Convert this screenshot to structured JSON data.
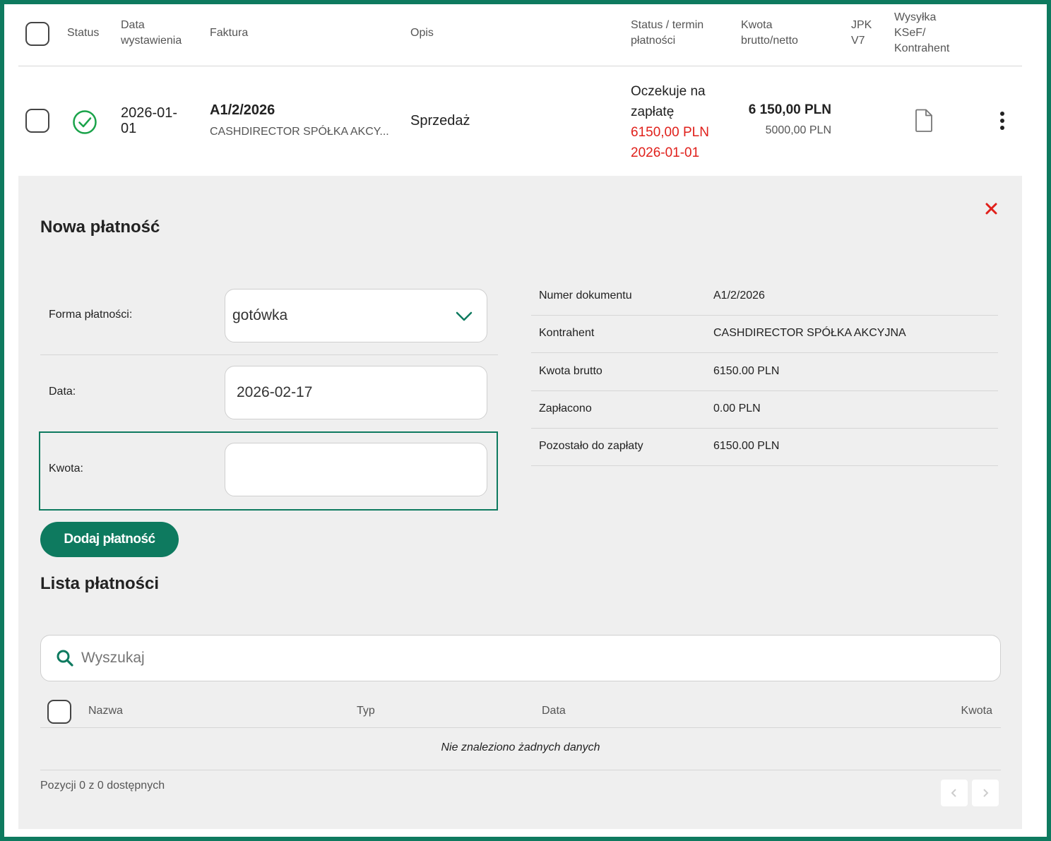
{
  "table": {
    "headers": {
      "status": "Status",
      "data_wystawienia": [
        "Data",
        "wystawienia"
      ],
      "faktura": "Faktura",
      "opis": "Opis",
      "status_termin": [
        "Status / termin",
        "płatności"
      ],
      "kwota": [
        "Kwota",
        "brutto/netto"
      ],
      "jpk": [
        "JPK",
        "V7"
      ],
      "wysylka": [
        "Wysyłka",
        "KSeF/",
        "Kontrahent"
      ]
    },
    "row": {
      "date": [
        "2026-01-",
        "01"
      ],
      "invoice_number": "A1/2/2026",
      "invoice_counterparty": "CASHDIRECTOR SPÓŁKA AKCY...",
      "description": "Sprzedaż",
      "payment_status": [
        "Oczekuje na",
        "zapłatę"
      ],
      "payment_amount": "6150,00 PLN",
      "payment_due": "2026-01-01",
      "gross": "6 150,00 PLN",
      "net": "5000,00 PLN"
    }
  },
  "payment_form": {
    "title": "Nowa płatność",
    "method_label": "Forma płatności:",
    "method_value": "gotówka",
    "date_label": "Data:",
    "date_value": "2026-02-17",
    "amount_label": "Kwota:",
    "amount_value": "",
    "submit_label": "Dodaj płatność"
  },
  "document_info": [
    {
      "label": "Numer dokumentu",
      "value": "A1/2/2026"
    },
    {
      "label": "Kontrahent",
      "value": "CASHDIRECTOR SPÓŁKA AKCYJNA"
    },
    {
      "label": "Kwota brutto",
      "value": "6150.00 PLN"
    },
    {
      "label": "Zapłacono",
      "value": "0.00 PLN"
    },
    {
      "label": "Pozostało do zapłaty",
      "value": "6150.00 PLN"
    }
  ],
  "payment_list": {
    "title": "Lista płatności",
    "search_placeholder": "Wyszukaj",
    "columns": {
      "name": "Nazwa",
      "type": "Typ",
      "date": "Data",
      "amount": "Kwota"
    },
    "empty_message": "Nie znaleziono żadnych danych",
    "footer": "Pozycji 0 z 0 dostępnych"
  },
  "colors": {
    "accent": "#0e7a5f",
    "danger": "#e0201b",
    "ok": "#1aa34a"
  },
  "icons": {
    "status": "check-circle-icon",
    "document": "document-icon",
    "menu": "more-vertical-icon",
    "close": "close-icon",
    "dropdown": "chevron-down-icon",
    "search": "search-icon",
    "prev": "chevron-left-icon",
    "next": "chevron-right-icon"
  }
}
